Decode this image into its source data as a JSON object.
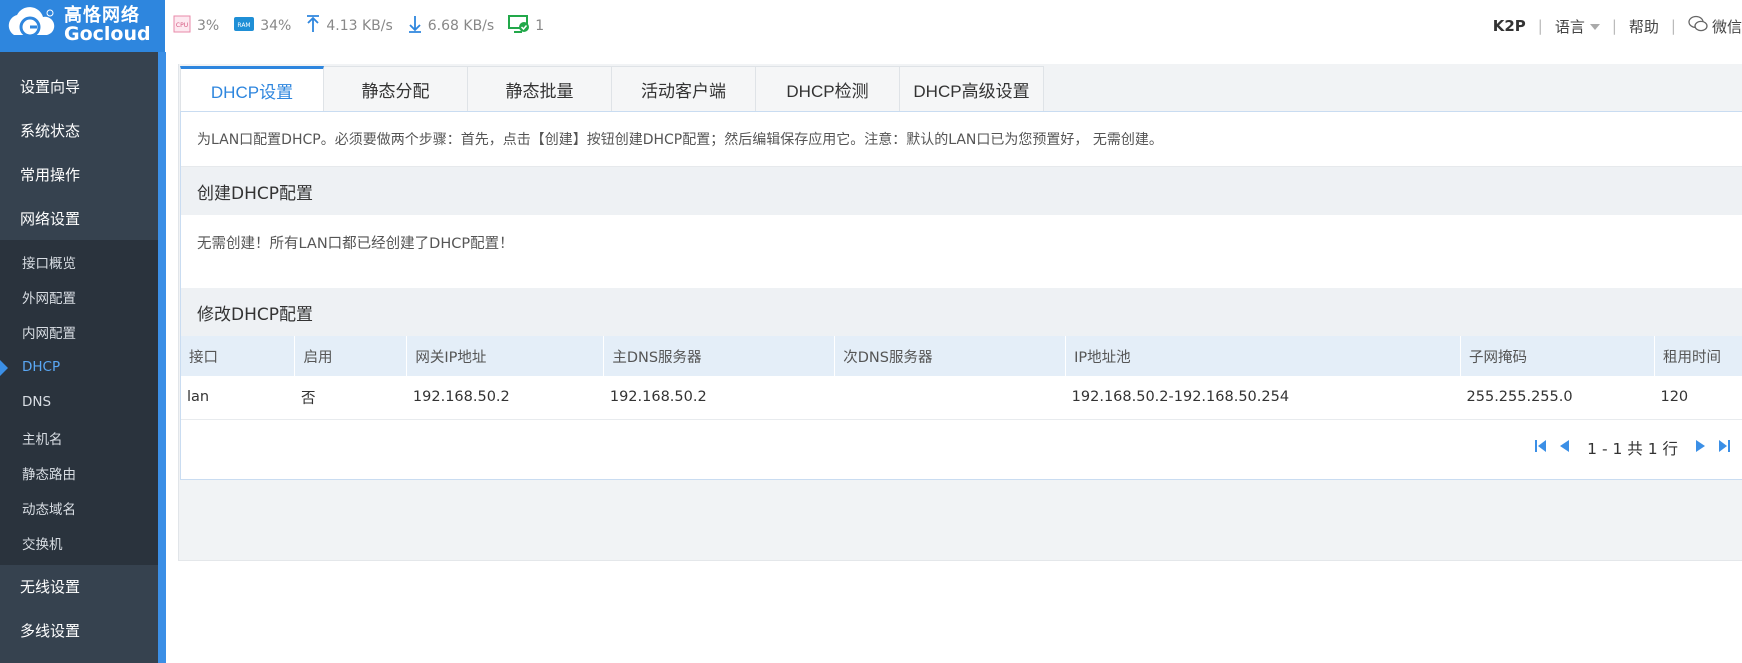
{
  "brand": {
    "name_cn": "高恪网络",
    "name_en": "Gocloud",
    "color": "#2e86de"
  },
  "stats": {
    "cpu_icon": "cpu-chip-icon",
    "cpu": "3%",
    "ram_icon": "ram-chip-icon",
    "ram": "34%",
    "upload_icon": "upload-arrow-icon",
    "upload": "4.13 KB/s",
    "download_icon": "download-arrow-icon",
    "download": "6.68 KB/s",
    "devices_icon": "monitor-check-icon",
    "devices": "1"
  },
  "header": {
    "model": "K2P",
    "language": "语言",
    "help": "帮助",
    "wechat": "微信"
  },
  "sidebar": {
    "main_top": [
      "设置向导",
      "系统状态",
      "常用操作",
      "网络设置"
    ],
    "sub": [
      "接口概览",
      "外网配置",
      "内网配置",
      "DHCP",
      "DNS",
      "主机名",
      "静态路由",
      "动态域名",
      "交换机"
    ],
    "active_sub": "DHCP",
    "main_bottom": [
      "无线设置",
      "多线设置"
    ]
  },
  "tabs": [
    "DHCP设置",
    "静态分配",
    "静态批量",
    "活动客户端",
    "DHCP检测",
    "DHCP高级设置"
  ],
  "active_tab": "DHCP设置",
  "intro": "为LAN口配置DHCP。必须要做两个步骤：首先，点击【创建】按钮创建DHCP配置；然后编辑保存应用它。注意：默认的LAN口已为您预置好， 无需创建。",
  "create_section": {
    "title": "创建DHCP配置",
    "message": "无需创建！所有LAN口都已经创建了DHCP配置！"
  },
  "edit_section": {
    "title": "修改DHCP配置",
    "columns": [
      "接口",
      "启用",
      "网关IP地址",
      "主DNS服务器",
      "次DNS服务器",
      "IP地址池",
      "子网掩码",
      "租用时间"
    ],
    "rows": [
      [
        "lan",
        "否",
        "192.168.50.2",
        "192.168.50.2",
        "",
        "192.168.50.2-192.168.50.254",
        "255.255.255.0",
        "120"
      ]
    ]
  },
  "pagination": {
    "text": "1 - 1 共 1 行"
  }
}
